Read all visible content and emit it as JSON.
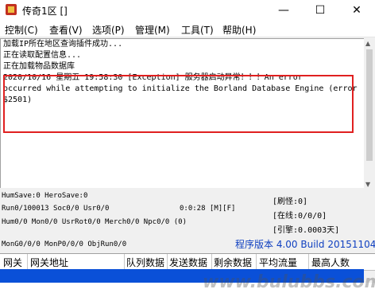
{
  "window": {
    "title": "传奇1区 []",
    "minimize_glyph": "—",
    "maximize_glyph": "☐",
    "close_glyph": "✕"
  },
  "menu": [
    {
      "label": "控制(C)"
    },
    {
      "label": "查看(V)"
    },
    {
      "label": "选项(P)"
    },
    {
      "label": "管理(M)"
    },
    {
      "label": "工具(T)"
    },
    {
      "label": "帮助(H)"
    }
  ],
  "log": {
    "lines": [
      "加载IP所在地区查询插件成功...",
      "正在读取配置信息...",
      "正在加载物品数据库",
      "2020/10/16 星期五 19:58:30 [Exception] 服务器启动异常！！！An error",
      "occurred while attempting to initialize the Borland Database Engine (error",
      "$2501)"
    ]
  },
  "stats": {
    "line1": "HumSave:0 HeroSave:0",
    "line2": "Run0/100013 Soc0/0 Usr0/0",
    "line2_time": "0:0:28 [M][F]",
    "line3": "Hum0/0 Mon0/0 UsrRot0/0 Merch0/0 Npc0/0 (0)",
    "line4": "MonG0/0/0 MonP0/0/0 ObjRun0/0"
  },
  "right_panel": {
    "monster": "[刷怪:0]",
    "online": "[在线:0/0/0]",
    "uptime": "[引擎:0.0003天]"
  },
  "version": {
    "label": "程序版本",
    "value": "4.00 Build 20151104"
  },
  "grid": {
    "columns": [
      "网关",
      "网关地址",
      "队列数据",
      "发送数据",
      "剩余数据",
      "平均流量",
      "最高人数"
    ]
  },
  "watermark": {
    "text": "www.bulubbs.com"
  },
  "colors": {
    "highlight": "#e02020",
    "selection": "#0a50d8"
  }
}
